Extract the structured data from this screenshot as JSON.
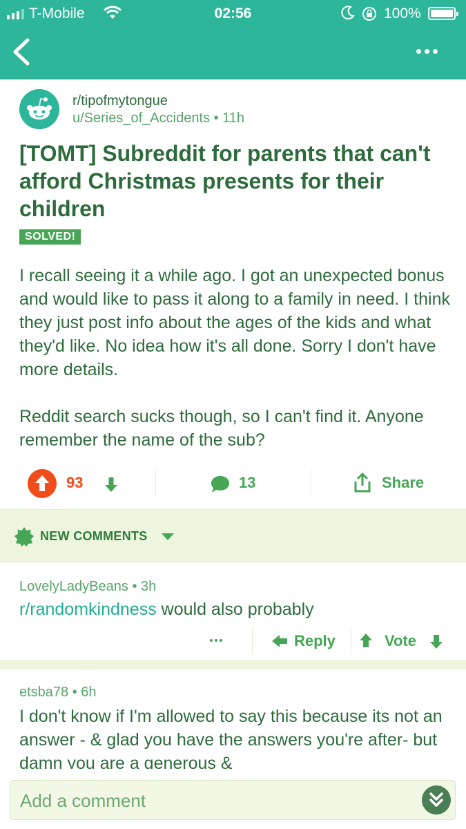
{
  "status_bar": {
    "carrier": "T-Mobile",
    "time": "02:56",
    "battery": "100%",
    "icons": [
      "signal-icon",
      "wifi-icon",
      "moon-icon",
      "rotation-lock-icon",
      "battery-icon"
    ]
  },
  "nav": {
    "icons": [
      "back-chevron-icon",
      "more-dots-icon"
    ]
  },
  "post": {
    "subreddit": "r/tipofmytongue",
    "author": "u/Series_of_Accidents",
    "age": "11h",
    "title": "[TOMT] Subreddit for parents that can't afford Christmas presents for their children",
    "flair": "SOLVED!",
    "body": [
      "I recall seeing it a while ago. I got an unexpected bonus and would like to pass it along to a family in need. I think they just post info about the ages of the kids and what they'd like. No idea how it's all done. Sorry I don't have more details.",
      "Reddit search sucks though, so I can't find it. Anyone remember the name of the sub?"
    ],
    "score": "93",
    "comment_count": "13",
    "share_label": "Share"
  },
  "new_comments": {
    "label": "NEW COMMENTS"
  },
  "comments": [
    {
      "author": "LovelyLadyBeans",
      "age": "3h",
      "link_text": "r/randomkindness",
      "text": " would also probably",
      "reply_label": "Reply",
      "vote_label": "Vote"
    },
    {
      "author": "etsba78",
      "age": "6h",
      "text": "I don't know if I'm allowed to say this because its not an answer - & glad you have the answers you're after- but damn you are a generous &"
    }
  ],
  "composer": {
    "placeholder": "Add a comment"
  },
  "colors": {
    "header": "#2db69a",
    "text": "#2e6b3c",
    "accent_green": "#46a655",
    "upvoted": "#f24c1a",
    "link": "#1fae94",
    "highlight_bg": "#eef5de"
  }
}
